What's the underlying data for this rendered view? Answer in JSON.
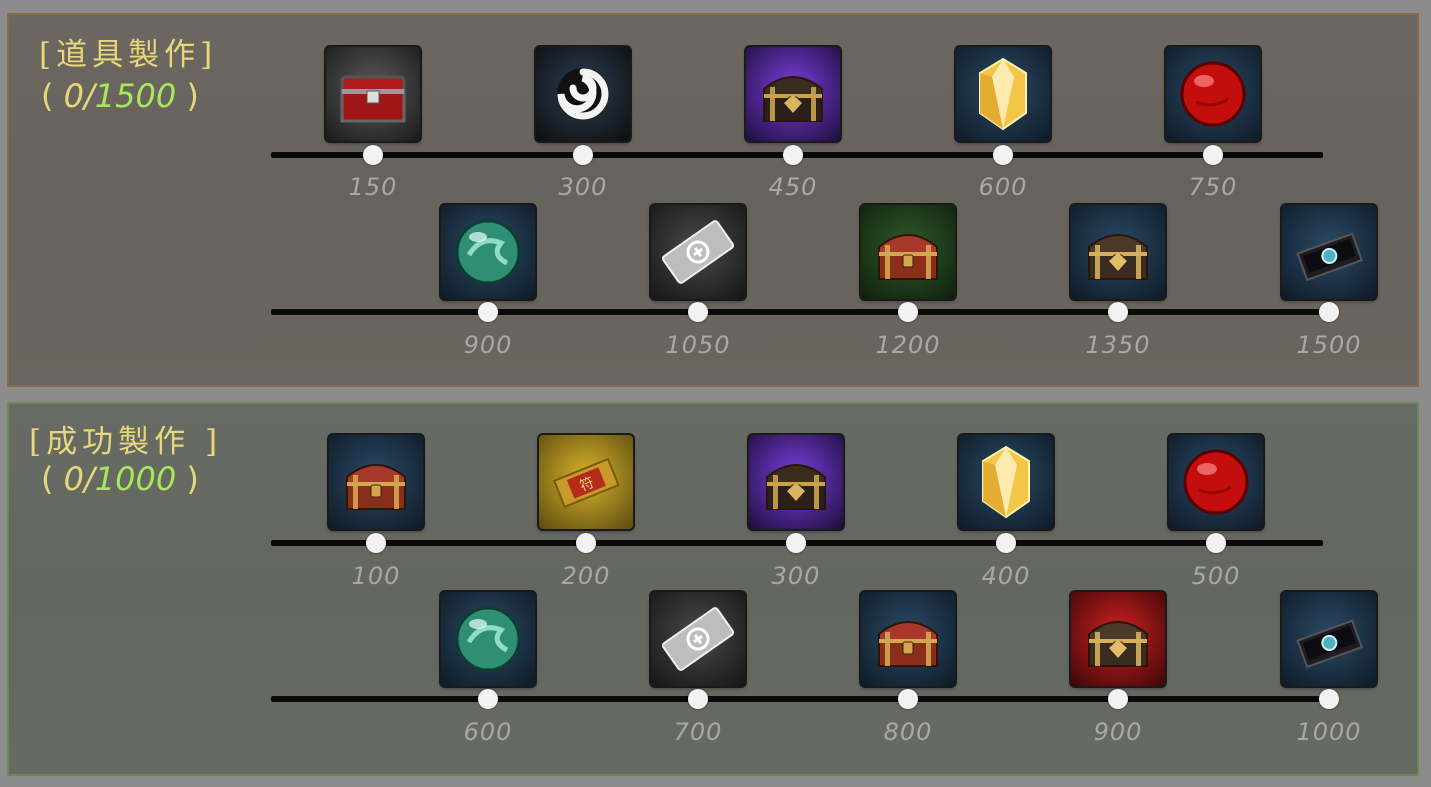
{
  "panels": {
    "item_craft": {
      "title": "[道具製作]",
      "progress_current": "0",
      "progress_total": "1500",
      "rows": [
        {
          "rewards": [
            {
              "threshold": "150",
              "icon": "red-chest-icon"
            },
            {
              "threshold": "300",
              "icon": "white-swirl-icon"
            },
            {
              "threshold": "450",
              "icon": "purple-ornate-chest-icon"
            },
            {
              "threshold": "600",
              "icon": "gold-crystal-icon"
            },
            {
              "threshold": "750",
              "icon": "red-orb-icon"
            }
          ]
        },
        {
          "rewards": [
            {
              "threshold": "900",
              "icon": "jade-orb-icon"
            },
            {
              "threshold": "1050",
              "icon": "silver-ticket-icon"
            },
            {
              "threshold": "1200",
              "icon": "wooden-chest-green-icon"
            },
            {
              "threshold": "1350",
              "icon": "ornate-chest-icon"
            },
            {
              "threshold": "1500",
              "icon": "jewel-box-icon"
            }
          ]
        }
      ]
    },
    "success_craft": {
      "title": "[成功製作 ]",
      "progress_current": "0",
      "progress_total": "1000",
      "rows": [
        {
          "rewards": [
            {
              "threshold": "100",
              "icon": "wooden-chest-icon"
            },
            {
              "threshold": "200",
              "icon": "gold-talisman-icon"
            },
            {
              "threshold": "300",
              "icon": "purple-ornate-chest-icon"
            },
            {
              "threshold": "400",
              "icon": "gold-crystal-icon"
            },
            {
              "threshold": "500",
              "icon": "red-orb-icon"
            }
          ]
        },
        {
          "rewards": [
            {
              "threshold": "600",
              "icon": "jade-orb-icon"
            },
            {
              "threshold": "700",
              "icon": "silver-ticket-icon"
            },
            {
              "threshold": "800",
              "icon": "wooden-chest-icon"
            },
            {
              "threshold": "900",
              "icon": "red-ornate-chest-icon"
            },
            {
              "threshold": "1000",
              "icon": "jewel-box-icon"
            }
          ]
        }
      ]
    }
  },
  "colors": {
    "title": "#e8d77a",
    "progress_total": "#a6e85a",
    "threshold_text": "#a8a8a8",
    "item_panel_border": "#8a6a4a",
    "success_panel_border": "#6b8a4e"
  }
}
